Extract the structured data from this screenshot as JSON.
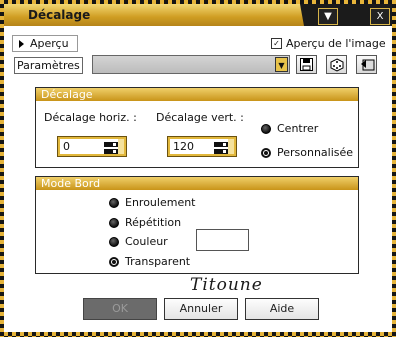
{
  "window": {
    "title": "Décalage"
  },
  "titlebar_buttons": {
    "menu": "▼",
    "close": "X"
  },
  "toolbar": {
    "preview_label": "Aperçu",
    "image_preview_label": "Aperçu de l'image",
    "image_preview_checked": true,
    "params_label": "Paramètres",
    "params_value": "",
    "tool_icons": [
      "save-icon",
      "dice-icon",
      "reset-icon"
    ]
  },
  "offset_group": {
    "title": "Décalage",
    "horiz_label": "Décalage horiz. :",
    "horiz_value": "0",
    "vert_label": "Décalage vert. :",
    "vert_value": "120",
    "options": [
      {
        "label": "Centrer",
        "selected": false
      },
      {
        "label": "Personnalisée",
        "selected": true
      }
    ]
  },
  "edge_group": {
    "title": "Mode Bord",
    "options": [
      {
        "label": "Enroulement",
        "selected": false
      },
      {
        "label": "Répétition",
        "selected": false
      },
      {
        "label": "Couleur",
        "selected": false
      },
      {
        "label": "Transparent",
        "selected": true
      }
    ],
    "color_swatch": "#ffffff"
  },
  "signature": "Titoune",
  "buttons": {
    "ok": "OK",
    "cancel": "Annuler",
    "help": "Aide"
  },
  "colors": {
    "accent_gold": "#d7a52a",
    "dark": "#151515"
  }
}
